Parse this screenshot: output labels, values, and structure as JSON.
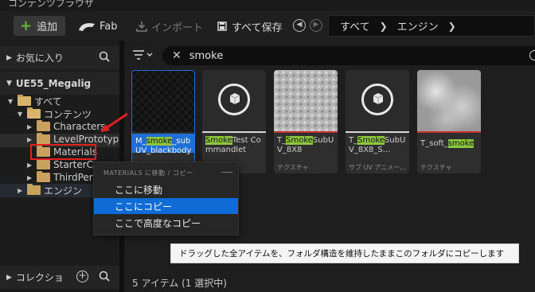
{
  "window": {
    "tab_title": "コンテンツブラウザ"
  },
  "toolbar": {
    "add_label": "追加",
    "fab_label": "Fab",
    "import_label": "インポート",
    "save_all_label": "すべて保存",
    "path": [
      "すべて",
      "エンジン"
    ]
  },
  "sidebar": {
    "favorites_label": "お気に入り",
    "project_label": "UE55_Megalig",
    "collections_label": "コレクショ",
    "tree": {
      "all": "すべて",
      "content": "コンテンツ",
      "children": [
        "Characters",
        "LevelPrototyp",
        "Materials",
        "StarterCo",
        "ThirdPers"
      ],
      "engine": "エンジン"
    }
  },
  "search": {
    "value": "smoke"
  },
  "assets": [
    {
      "pre": "M_",
      "hl": "smoke",
      "post": "_subUV_blackbody",
      "type": ""
    },
    {
      "pre": "",
      "hl": "Smoke",
      "post": "Test Commandlet",
      "type": ""
    },
    {
      "pre": "T_",
      "hl": "Smoke",
      "post": "SubUV_8X8",
      "type": "テクスチャ"
    },
    {
      "pre": "T_",
      "hl": "Smoke",
      "post": "SubUV_8X8_S...",
      "type": "サブ UV アニメー..."
    },
    {
      "pre": "T_soft_",
      "hl": "smoke",
      "post": "",
      "type": "テクスチャ"
    }
  ],
  "status": {
    "text": "5 アイテム (1 選択中)"
  },
  "context_menu": {
    "header": "MATERIALS に移動 / コピー",
    "items": [
      "ここに移動",
      "ここにコピー",
      "ここで高度なコピー"
    ]
  },
  "tooltip": {
    "text": "ドラッグした全アイテムを、フォルダ構造を維持したままこのフォルダにコピーします"
  },
  "colors": {
    "accent_blue": "#0f6bd6",
    "highlight_green": "#8cc63f",
    "folder": "#c8a25d",
    "texture_bar": "#c4302b"
  }
}
